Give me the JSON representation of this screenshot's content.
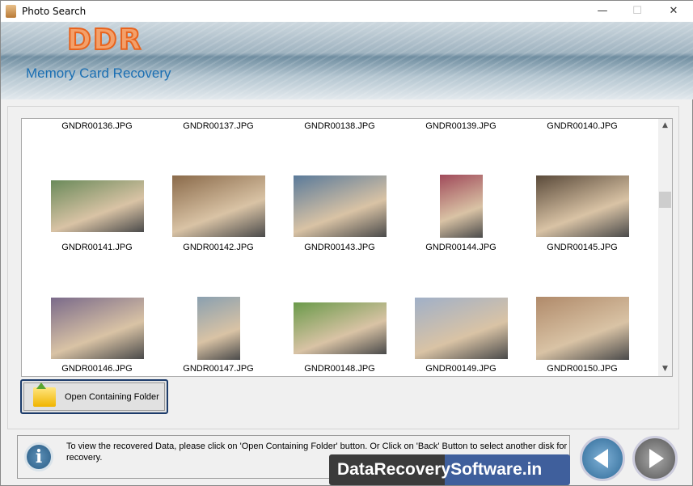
{
  "window": {
    "title": "Photo Search",
    "minimize": "—",
    "maximize": "☐",
    "close": "✕"
  },
  "banner": {
    "logo": "DDR",
    "subtitle": "Memory Card Recovery"
  },
  "grid": {
    "top_labels": [
      "GNDR00136.JPG",
      "GNDR00137.JPG",
      "GNDR00138.JPG",
      "GNDR00139.JPG",
      "GNDR00140.JPG"
    ],
    "rows": [
      [
        "GNDR00141.JPG",
        "GNDR00142.JPG",
        "GNDR00143.JPG",
        "GNDR00144.JPG",
        "GNDR00145.JPG"
      ],
      [
        "GNDR00146.JPG",
        "GNDR00147.JPG",
        "GNDR00148.JPG",
        "GNDR00149.JPG",
        "GNDR00150.JPG"
      ]
    ]
  },
  "actions": {
    "open_folder": "Open Containing Folder"
  },
  "status": {
    "message": "To view the recovered Data, please click on 'Open Containing Folder' button. Or Click on 'Back' Button to select another disk for recovery.",
    "info_icon": "i"
  },
  "watermark": "DataRecoverySoftware.in"
}
